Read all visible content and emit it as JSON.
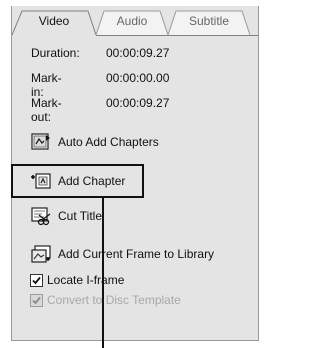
{
  "tabs": [
    {
      "label": "Video",
      "active": true
    },
    {
      "label": "Audio",
      "active": false
    },
    {
      "label": "Subtitle",
      "active": false
    }
  ],
  "info": {
    "duration_label": "Duration:",
    "duration_value": "00:00:09.27",
    "markin_label": "Mark-in:",
    "markin_value": "00:00:00.00",
    "markout_label": "Mark-out:",
    "markout_value": "00:00:09.27"
  },
  "actions": {
    "auto_add_chapters": "Auto Add Chapters",
    "add_chapter": "Add Chapter",
    "cut_title": "Cut Title",
    "add_frame_to_library": "Add Current Frame to Library"
  },
  "options": {
    "locate_iframe": {
      "label": "Locate I-frame",
      "checked": true,
      "enabled": true
    },
    "convert_template": {
      "label": "Convert to Disc Template",
      "checked": true,
      "enabled": false
    }
  }
}
